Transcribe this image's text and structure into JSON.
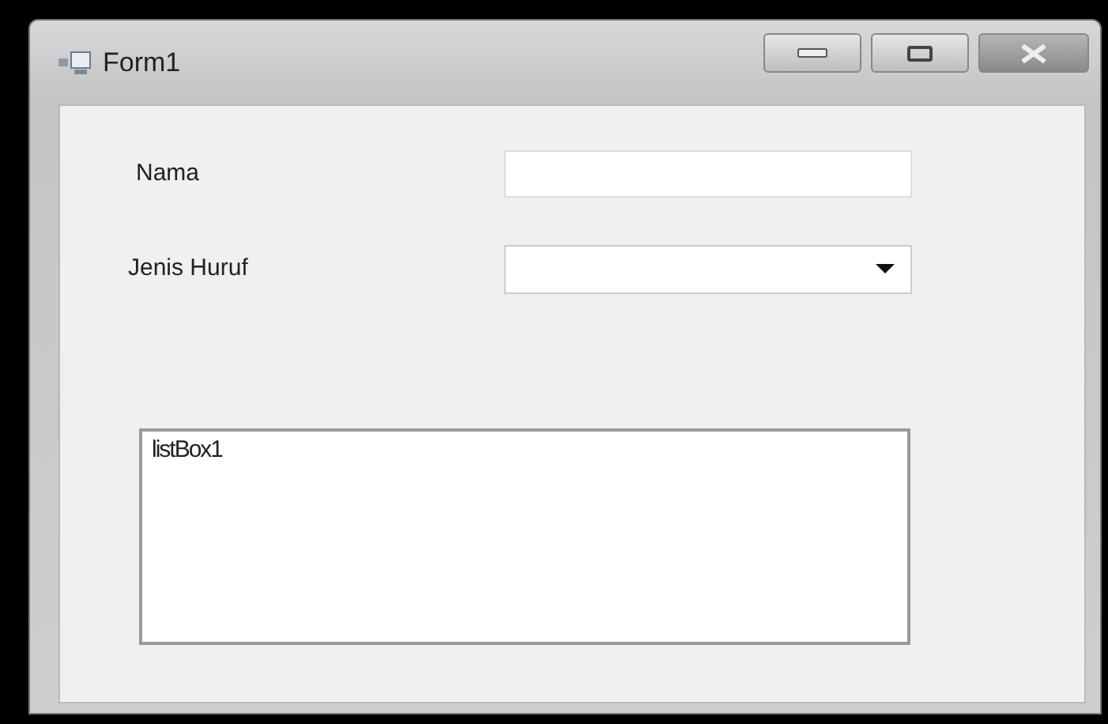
{
  "window": {
    "title": "Form1"
  },
  "fields": [
    {
      "label": "Nama",
      "kind": "textbox"
    },
    {
      "label": "Jenis Huruf",
      "kind": "combobox"
    }
  ],
  "listbox": {
    "items": [
      "listBox1"
    ]
  }
}
